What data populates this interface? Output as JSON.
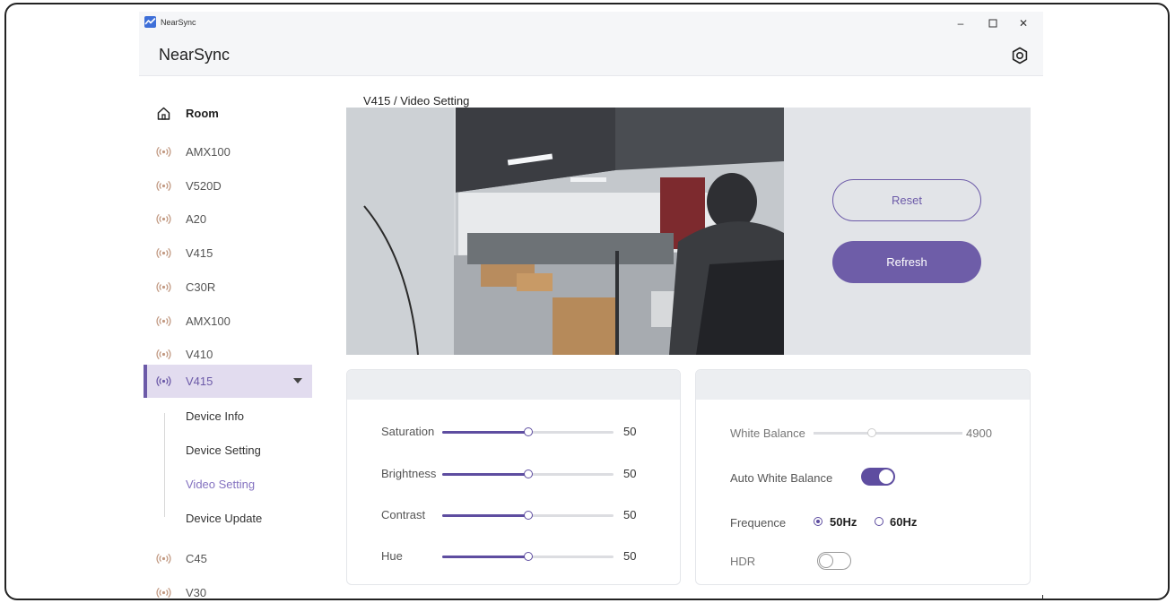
{
  "window": {
    "titlebar_text": "NearSync",
    "app_title": "NearSync"
  },
  "icons": {
    "app": "app-logo-icon",
    "settings": "gear-icon",
    "room": "home-icon",
    "device": "wireless-broadcast-icon"
  },
  "colors": {
    "accent": "#6e5da8",
    "active_bg": "#e2dcef",
    "sub_current": "#8472c0"
  },
  "sidebar": {
    "room_label": "Room",
    "devices": [
      "AMX100",
      "V520D",
      "A20",
      "V415",
      "C30R",
      "AMX100",
      "V410"
    ],
    "active_device": "V415",
    "sub_items": [
      "Device Info",
      "Device Setting",
      "Video Setting",
      "Device Update"
    ],
    "current_sub_item": "Video Setting",
    "more_devices": [
      "C45",
      "V30"
    ]
  },
  "breadcrumb": "V415 / Video Setting",
  "buttons": {
    "reset": "Reset",
    "refresh": "Refresh"
  },
  "image_controls": [
    {
      "label": "Saturation",
      "value": "50",
      "fraction": 0.5
    },
    {
      "label": "Brightness",
      "value": "50",
      "fraction": 0.5
    },
    {
      "label": "Contrast",
      "value": "50",
      "fraction": 0.5
    },
    {
      "label": "Hue",
      "value": "50",
      "fraction": 0.5
    }
  ],
  "white_balance": {
    "label": "White Balance",
    "value": "4900",
    "fraction": 0.39
  },
  "auto_white_balance": {
    "label": "Auto White Balance",
    "on": true
  },
  "frequence": {
    "label": "Frequence",
    "options": [
      "50Hz",
      "60Hz"
    ],
    "selected": "50Hz"
  },
  "hdr": {
    "label": "HDR",
    "on": false
  }
}
